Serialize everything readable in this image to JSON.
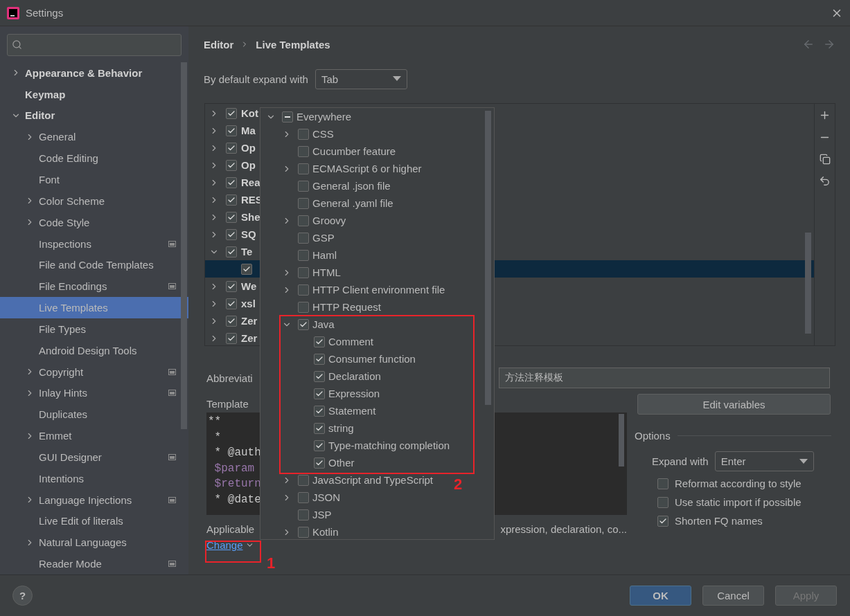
{
  "window": {
    "title": "Settings"
  },
  "sidebar": {
    "items": [
      {
        "label": "Appearance & Behavior",
        "expanded": false,
        "selected": false
      },
      {
        "label": "Keymap",
        "selected": false
      },
      {
        "label": "Editor",
        "expanded": true,
        "selected": false,
        "children": [
          {
            "label": "General",
            "expanded": false,
            "selected": false
          },
          {
            "label": "Code Editing",
            "selected": false
          },
          {
            "label": "Font",
            "selected": false
          },
          {
            "label": "Color Scheme",
            "expanded": false,
            "selected": false
          },
          {
            "label": "Code Style",
            "expanded": false,
            "selected": false
          },
          {
            "label": "Inspections",
            "project": true,
            "selected": false
          },
          {
            "label": "File and Code Templates",
            "selected": false
          },
          {
            "label": "File Encodings",
            "project": true,
            "selected": false
          },
          {
            "label": "Live Templates",
            "selected": true
          },
          {
            "label": "File Types",
            "selected": false
          },
          {
            "label": "Android Design Tools",
            "selected": false
          },
          {
            "label": "Copyright",
            "expanded": false,
            "project": true,
            "selected": false
          },
          {
            "label": "Inlay Hints",
            "expanded": false,
            "project": true,
            "selected": false
          },
          {
            "label": "Duplicates",
            "selected": false
          },
          {
            "label": "Emmet",
            "expanded": false,
            "selected": false
          },
          {
            "label": "GUI Designer",
            "project": true,
            "selected": false
          },
          {
            "label": "Intentions",
            "selected": false
          },
          {
            "label": "Language Injections",
            "expanded": false,
            "project": true,
            "selected": false
          },
          {
            "label": "Live Edit of literals",
            "selected": false
          },
          {
            "label": "Natural Languages",
            "expanded": false,
            "selected": false
          },
          {
            "label": "Reader Mode",
            "project": true,
            "selected": false
          }
        ]
      }
    ]
  },
  "breadcrumb": [
    "Editor",
    "Live Templates"
  ],
  "default_expand": {
    "label": "By default expand with",
    "value": "Tab"
  },
  "template_groups": [
    {
      "label": "Kot",
      "checked": true,
      "expanded": false,
      "selected": false
    },
    {
      "label": "Ma",
      "checked": true,
      "expanded": false,
      "selected": false
    },
    {
      "label": "Op",
      "checked": true,
      "expanded": false,
      "selected": false
    },
    {
      "label": "Op",
      "checked": true,
      "expanded": false,
      "selected": false
    },
    {
      "label": "Rea",
      "checked": true,
      "expanded": false,
      "selected": false
    },
    {
      "label": "RES",
      "checked": true,
      "expanded": false,
      "selected": false
    },
    {
      "label": "She",
      "checked": true,
      "expanded": false,
      "selected": false
    },
    {
      "label": "SQ",
      "checked": true,
      "expanded": false,
      "selected": false
    },
    {
      "label": "Te",
      "checked": true,
      "expanded": true,
      "selected": false,
      "children": [
        {
          "checked": true,
          "selected": true
        }
      ]
    },
    {
      "label": "We",
      "checked": true,
      "expanded": false,
      "selected": false
    },
    {
      "label": "xsl",
      "checked": true,
      "expanded": false,
      "selected": false
    },
    {
      "label": "Zer",
      "checked": true,
      "expanded": false,
      "selected": false
    },
    {
      "label": "Zer",
      "checked": true,
      "expanded": false,
      "selected": false
    }
  ],
  "abbreviation": {
    "label": "Abbreviati",
    "description": "方法注释模板"
  },
  "template_text": {
    "label": "Template",
    "lines": [
      {
        "text": "**",
        "kind": "text"
      },
      {
        "text": " *",
        "kind": "text"
      },
      {
        "text": " * @auth",
        "kind": "text"
      },
      {
        "text": " $param",
        "kind": "variable"
      },
      {
        "text": " $return",
        "kind": "variable"
      },
      {
        "text": " * @date",
        "kind": "text"
      }
    ]
  },
  "edit_variables": "Edit variables",
  "options": {
    "title": "Options",
    "expand_label": "Expand with",
    "expand_value": "Enter",
    "checkboxes": [
      {
        "label": "Reformat according to style",
        "checked": false
      },
      {
        "label": "Use static import if possible",
        "checked": false
      },
      {
        "label": "Shorten FQ names",
        "checked": true
      }
    ]
  },
  "applicable": {
    "label": "Applicable",
    "contexts": "xpression, declaration, co...",
    "change_link": "Change"
  },
  "scope_popup": {
    "items": [
      {
        "label": "Everywhere",
        "partial": true,
        "expanded": true,
        "children": [
          {
            "label": "CSS",
            "checked": false,
            "expanded": false
          },
          {
            "label": "Cucumber feature",
            "checked": false
          },
          {
            "label": "ECMAScript 6 or higher",
            "checked": false,
            "expanded": false
          },
          {
            "label": "General .json file",
            "checked": false
          },
          {
            "label": "General .yaml file",
            "checked": false
          },
          {
            "label": "Groovy",
            "checked": false,
            "expanded": false
          },
          {
            "label": "GSP",
            "checked": false
          },
          {
            "label": "Haml",
            "checked": false
          },
          {
            "label": "HTML",
            "checked": false,
            "expanded": false
          },
          {
            "label": "HTTP Client environment file",
            "checked": false,
            "expanded": false
          },
          {
            "label": "HTTP Request",
            "checked": false
          },
          {
            "label": "Java",
            "checked": true,
            "expanded": true,
            "children": [
              {
                "label": "Comment",
                "checked": true
              },
              {
                "label": "Consumer function",
                "checked": true
              },
              {
                "label": "Declaration",
                "checked": true
              },
              {
                "label": "Expression",
                "checked": true
              },
              {
                "label": "Statement",
                "checked": true
              },
              {
                "label": "string",
                "checked": true
              },
              {
                "label": "Type-matching completion",
                "checked": true
              },
              {
                "label": "Other",
                "checked": true
              }
            ]
          },
          {
            "label": "JavaScript and TypeScript",
            "checked": false,
            "expanded": false
          },
          {
            "label": "JSON",
            "checked": false,
            "expanded": false
          },
          {
            "label": "JSP",
            "checked": false
          },
          {
            "label": "Kotlin",
            "checked": false,
            "expanded": false
          }
        ]
      }
    ]
  },
  "annotations": [
    {
      "label": "1"
    },
    {
      "label": "2"
    }
  ],
  "help": "?",
  "buttons": [
    {
      "label": "OK",
      "kind": "primary",
      "disabled": false
    },
    {
      "label": "Cancel",
      "kind": "normal",
      "disabled": false
    },
    {
      "label": "Apply",
      "kind": "normal",
      "disabled": true
    }
  ]
}
